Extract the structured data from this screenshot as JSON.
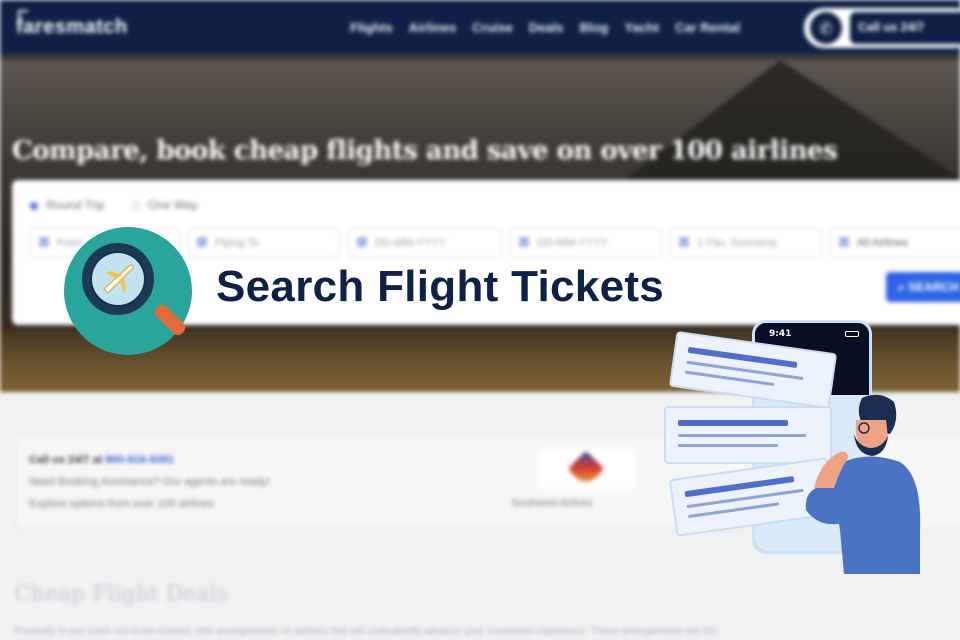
{
  "nav": {
    "logo": "faresmatch",
    "links": [
      "Flights",
      "Airlines",
      "Cruise",
      "Deals",
      "Blog",
      "Yacht",
      "Car Rental"
    ],
    "call_label": "Call us 24/7"
  },
  "hero": {
    "title": "Compare, book cheap flights and save on over 100 airlines",
    "trip_options": [
      "Round Trip",
      "One Way"
    ],
    "fields": {
      "from": "From",
      "to": "Flying To",
      "depart": "DD-MM-YYYY",
      "return": "DD-MM-YYYY",
      "travellers": "1 Pax, Economy",
      "airline": "All Airlines"
    },
    "search_button": "SEARCH"
  },
  "info": {
    "call_prefix": "Call us 24/7 at",
    "phone": "800-916-9391",
    "line2": "Need Booking Assistance? Our agents are ready!",
    "line3": "Explore options from over 100 airlines",
    "airline_name": "Southwest Airlines"
  },
  "deals": {
    "title": "Cheap Flight Deals",
    "text": "Presently is you some not-to-be-missed, elite arrangements on airfares that will undoubtedly advance your movement experience. These arrangements are the"
  },
  "overlay": {
    "headline": "Search Flight Tickets",
    "phone_time": "9:41"
  },
  "colors": {
    "navy": "#0f1f45",
    "accent_blue": "#2e63e6",
    "badge_teal": "#2aa59b",
    "headline": "#0e2146"
  },
  "icons": [
    "magnifier-plane-icon",
    "phone-icon",
    "calendar-icon",
    "person-icon",
    "search-icon"
  ]
}
